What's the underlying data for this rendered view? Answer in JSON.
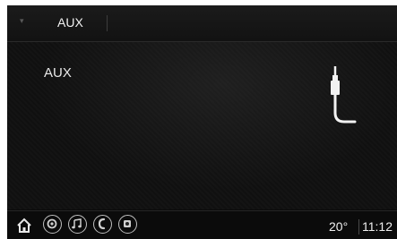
{
  "header": {
    "caret": "▾",
    "title": "AUX"
  },
  "main": {
    "source_label": "AUX",
    "source_icon": "aux-plug-icon"
  },
  "footer": {
    "buttons": [
      {
        "icon": "home-icon"
      },
      {
        "icon": "settings-icon"
      },
      {
        "icon": "music-note-icon"
      },
      {
        "icon": "phone-icon"
      },
      {
        "icon": "camera-icon"
      }
    ],
    "temperature": "20°",
    "clock": "11:12"
  }
}
